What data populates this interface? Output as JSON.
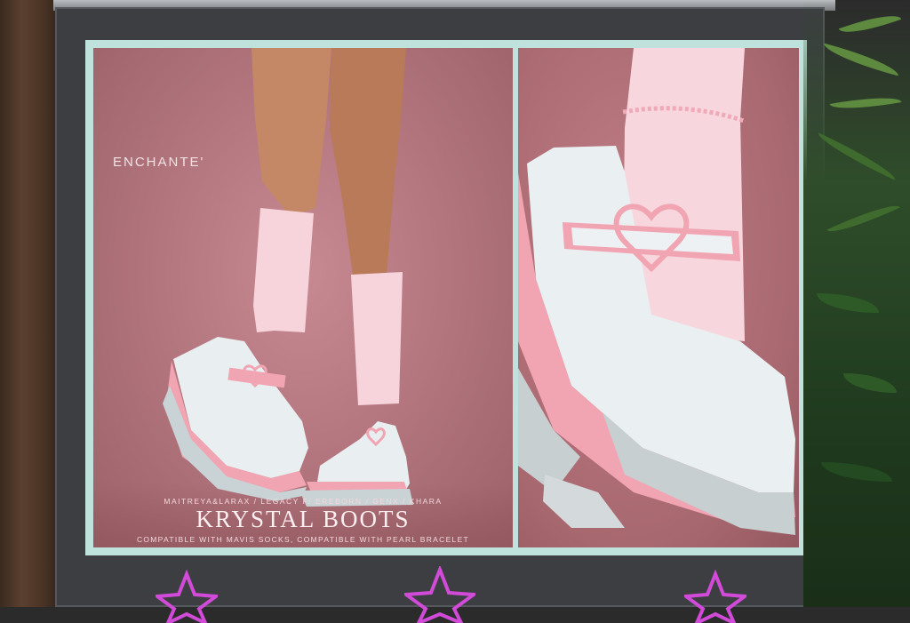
{
  "poster": {
    "brand": "ENCHANTE'",
    "body_list": "MAITREYA&LARAX / LEGACY F/ EREBORN / GENX / KHARA",
    "title": "KRYSTAL BOOTS",
    "compatibility": "COMPATIBLE WITH MAVIS SOCKS, COMPATIBLE WITH PEARL BRACELET"
  },
  "colors": {
    "poster_background": "#b0737b",
    "poster_border": "#bfe3dc",
    "shoe_white": "#e9eef0",
    "shoe_pink": "#f1a4b2",
    "sock_pink": "#f7d4dc",
    "neon_star": "#d24bd8"
  },
  "icons": [
    "heart-buckle-icon",
    "neon-star-icon"
  ]
}
